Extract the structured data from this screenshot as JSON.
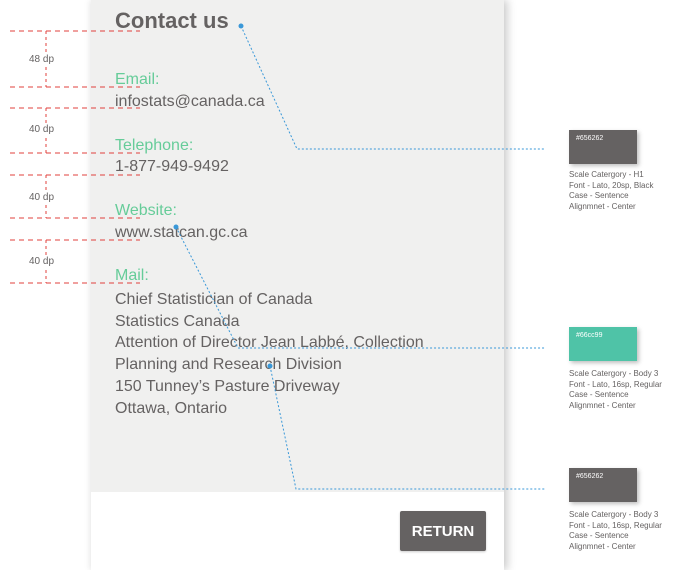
{
  "screen": {
    "title": "Contact us",
    "email": {
      "label": "Email:",
      "value": "infostats@canada.ca"
    },
    "telephone": {
      "label": "Telephone:",
      "value": "1-877-949-9492"
    },
    "website": {
      "label": "Website:",
      "value": "www.statcan.gc.ca"
    },
    "mail": {
      "label": "Mail:",
      "lines": [
        "Chief Statistician of Canada",
        "Statistics Canada",
        "Attention of Director Jean Labbé, Collection",
        "Planning and Research Division",
        "150 Tunney’s Pasture Driveway",
        "Ottawa, Ontario"
      ]
    },
    "return_button": "RETURN"
  },
  "spacing_annotations": [
    "48 dp",
    "40 dp",
    "40 dp",
    "40 dp"
  ],
  "swatches": [
    {
      "hex": "#656262",
      "color": "#656262",
      "note": [
        "Scale Catergory - H1",
        "Font - Lato, 20sp, Black",
        "Case - Sentence",
        "Alignmnet - Center"
      ]
    },
    {
      "hex": "#66cc99",
      "color": "#4fc3a7",
      "note": [
        "Scale Catergory - Body 3",
        "Font - Lato, 16sp, Regular",
        "Case - Sentence",
        "Alignmnet - Center"
      ]
    },
    {
      "hex": "#656262",
      "color": "#656262",
      "note": [
        "Scale Catergory - Body 3",
        "Font - Lato, 16sp, Regular",
        "Case - Sentence",
        "Alignmnet - Center"
      ]
    }
  ],
  "colors": {
    "text": "#656262",
    "accent": "#66cc99",
    "background": "#f0f0ef"
  }
}
